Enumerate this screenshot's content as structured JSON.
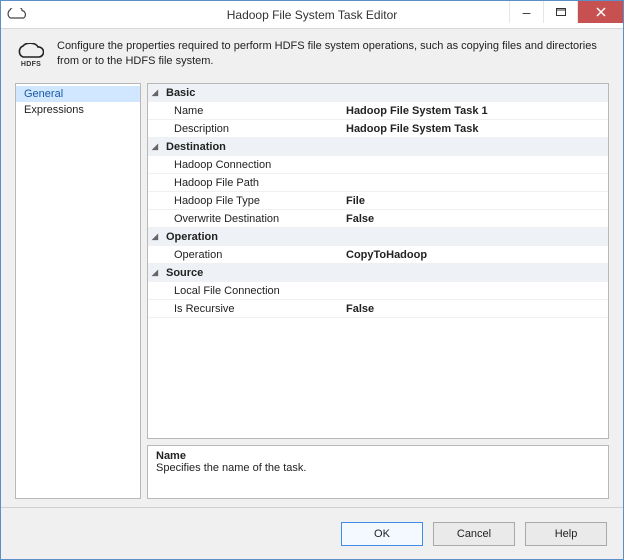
{
  "window": {
    "title": "Hadoop File System Task Editor",
    "icon_label": "HDFS"
  },
  "header": {
    "icon_label": "HDFS",
    "description": "Configure the properties required to perform HDFS file system operations, such as copying files and directories from or to the HDFS file system."
  },
  "nav": {
    "items": [
      {
        "label": "General",
        "selected": true
      },
      {
        "label": "Expressions",
        "selected": false
      }
    ]
  },
  "properties": {
    "categories": [
      {
        "name": "Basic",
        "rows": [
          {
            "label": "Name",
            "value": "Hadoop File System Task 1"
          },
          {
            "label": "Description",
            "value": "Hadoop File System Task"
          }
        ]
      },
      {
        "name": "Destination",
        "rows": [
          {
            "label": "Hadoop Connection",
            "value": ""
          },
          {
            "label": "Hadoop File Path",
            "value": ""
          },
          {
            "label": "Hadoop File Type",
            "value": "File"
          },
          {
            "label": "Overwrite Destination",
            "value": "False"
          }
        ]
      },
      {
        "name": "Operation",
        "rows": [
          {
            "label": "Operation",
            "value": "CopyToHadoop"
          }
        ]
      },
      {
        "name": "Source",
        "rows": [
          {
            "label": "Local File Connection",
            "value": ""
          },
          {
            "label": "Is Recursive",
            "value": "False"
          }
        ]
      }
    ]
  },
  "help_panel": {
    "title": "Name",
    "text": "Specifies the name of the task."
  },
  "buttons": {
    "ok": "OK",
    "cancel": "Cancel",
    "help": "Help"
  }
}
